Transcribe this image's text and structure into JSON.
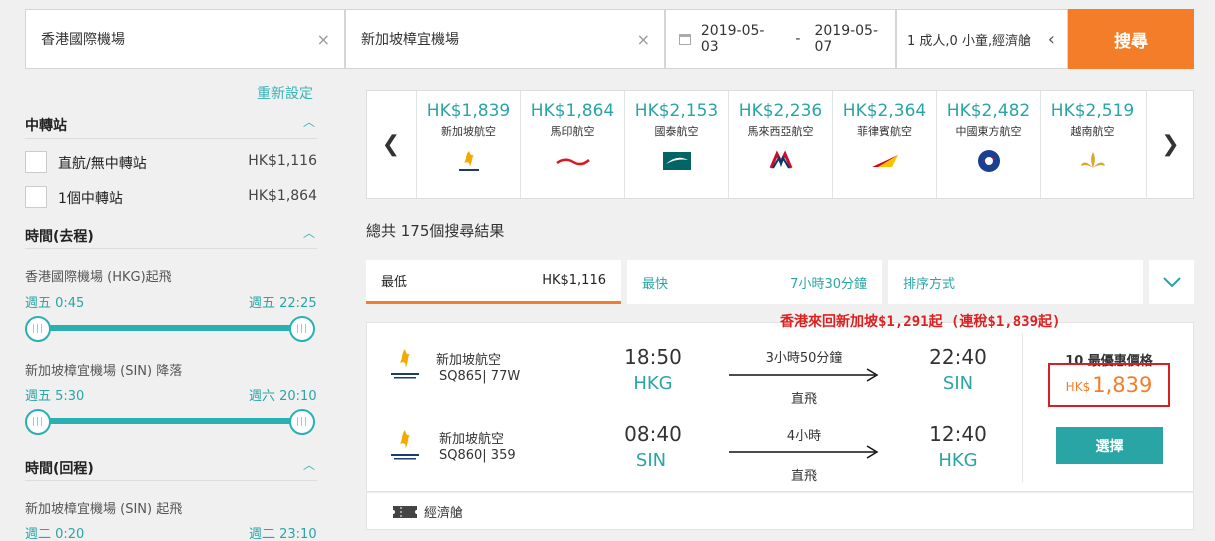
{
  "search": {
    "origin": "香港國際機場",
    "destination": "新加坡樟宜機場",
    "depart_date": "2019-05-03",
    "date_sep": "-",
    "return_date": "2019-05-07",
    "passengers": "1 成人,0 小童,經濟艙",
    "search_label": "搜尋",
    "clear_glyph": "×",
    "collapse_glyph": "‹"
  },
  "sidebar": {
    "reset_label": "重新設定",
    "stops_title": "中轉站",
    "stops": [
      {
        "label": "直航/無中轉站",
        "price": "HK$1,116"
      },
      {
        "label": "1個中轉站",
        "price": "HK$1,864"
      }
    ],
    "outbound_title": "時間(去程)",
    "outbound_depart_label": "香港國際機場 (HKG)起飛",
    "outbound_depart_range": [
      "週五 0:45",
      "週五 22:25"
    ],
    "outbound_arrive_label": "新加坡樟宜機場 (SIN) 降落",
    "outbound_arrive_range": [
      "週五 5:30",
      "週六 20:10"
    ],
    "return_title": "時間(回程)",
    "return_depart_label": "新加坡樟宜機場 (SIN) 起飛",
    "return_depart_range": [
      "週二 0:20",
      "週二 23:10"
    ]
  },
  "airlines": [
    {
      "price": "HK$1,839",
      "name": "新加坡航空",
      "icon": "singapore-airlines-logo"
    },
    {
      "price": "HK$1,864",
      "name": "馬印航空",
      "icon": "malindo-air-logo"
    },
    {
      "price": "HK$2,153",
      "name": "國泰航空",
      "icon": "cathay-pacific-logo"
    },
    {
      "price": "HK$2,236",
      "name": "馬來西亞航空",
      "icon": "malaysia-airlines-logo"
    },
    {
      "price": "HK$2,364",
      "name": "菲律賓航空",
      "icon": "philippine-airlines-logo"
    },
    {
      "price": "HK$2,482",
      "name": "中國東方航空",
      "icon": "china-eastern-logo"
    },
    {
      "price": "HK$2,519",
      "name": "越南航空",
      "icon": "vietnam-airlines-logo"
    }
  ],
  "results": {
    "total": "總共 175個搜尋結果",
    "tabs": [
      {
        "label": "最低",
        "value": "HK$1,116"
      },
      {
        "label": "最快",
        "value": "7小時30分鐘"
      },
      {
        "label": "排序方式",
        "value": ""
      }
    ]
  },
  "promo": "香港來回新加坡$1,291起 (連稅$1,839起)",
  "flight": {
    "outbound": {
      "airline": "新加坡航空",
      "code": "SQ865| 77W",
      "dep_time": "18:50",
      "dep_apt": "HKG",
      "duration": "3小時50分鐘",
      "stops": "直飛",
      "arr_time": "22:40",
      "arr_apt": "SIN"
    },
    "inbound": {
      "airline": "新加坡航空",
      "code": "SQ860| 359",
      "dep_time": "08:40",
      "dep_apt": "SIN",
      "duration": "4小時",
      "stops": "直飛",
      "arr_time": "12:40",
      "arr_apt": "HKG"
    },
    "best_label": "10 最優惠價格",
    "currency": "HK$",
    "price": "1,839",
    "select_label": "選擇",
    "cabin": "經濟艙"
  },
  "colors": {
    "accent": "#f37d28",
    "teal": "#2aa5a5",
    "promo": "#e02020"
  }
}
